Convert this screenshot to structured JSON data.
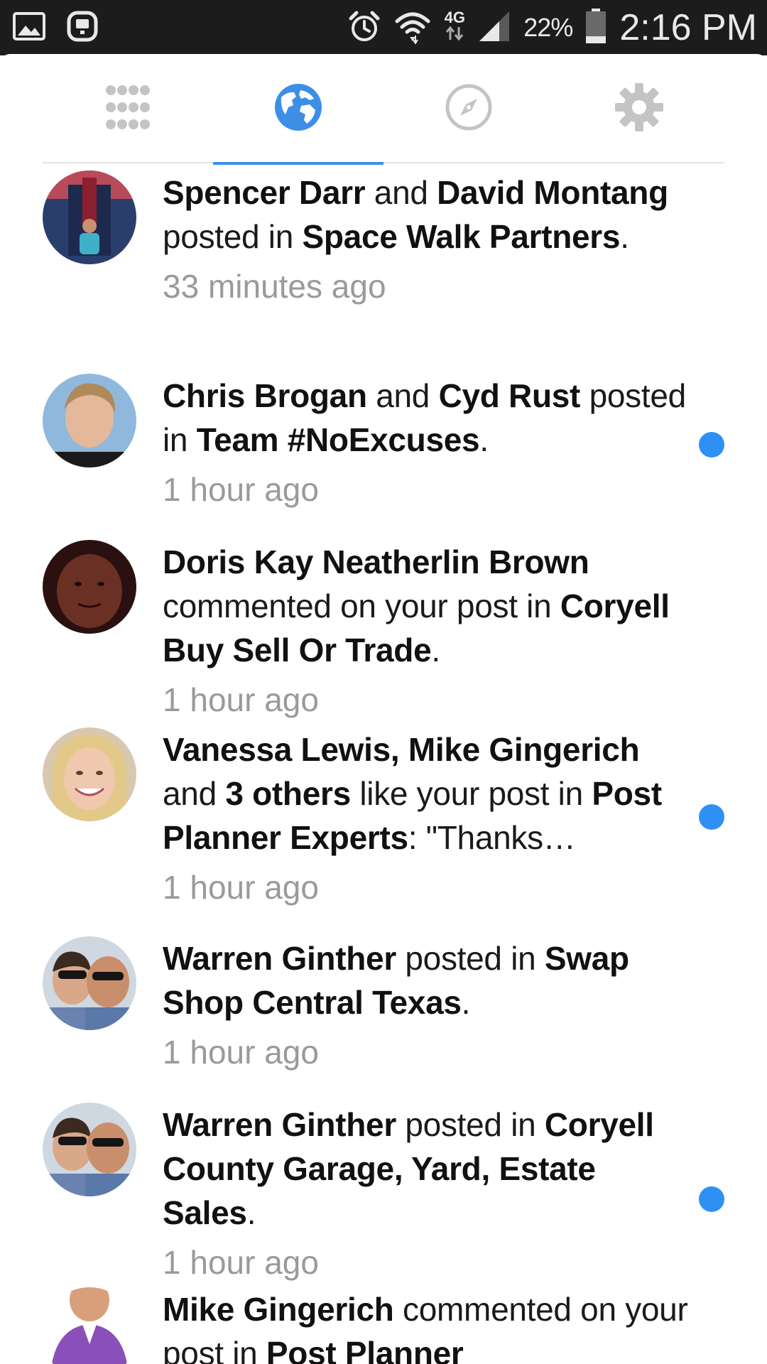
{
  "status_bar": {
    "network": "4G",
    "battery_percent": "22%",
    "battery_level": 0.22,
    "time": "2:16 PM",
    "icons": [
      "gallery-icon",
      "app-notification-icon",
      "alarm-icon",
      "wifi-icon",
      "data-arrows-icon",
      "signal-icon",
      "battery-icon"
    ]
  },
  "tabs": [
    {
      "name": "apps-grid-icon",
      "active": false
    },
    {
      "name": "notifications-globe-icon",
      "active": true
    },
    {
      "name": "explore-compass-icon",
      "active": false
    },
    {
      "name": "settings-gear-icon",
      "active": false
    }
  ],
  "colors": {
    "accent": "#3d8fe6",
    "unread": "#2e90f3",
    "timestamp": "#9a9a9a",
    "status_bar": "#1c1c1c"
  },
  "notifications": [
    {
      "segments": [
        {
          "t": "Spencer Darr",
          "b": true
        },
        {
          "t": " and ",
          "b": false
        },
        {
          "t": "David Montang",
          "b": true
        },
        {
          "t": " posted in ",
          "b": false
        },
        {
          "t": "Space Walk Partners",
          "b": true
        },
        {
          "t": ".",
          "b": false
        }
      ],
      "time": "33 minutes ago",
      "unread": false,
      "avatar": "person-red-backdrop"
    },
    {
      "segments": [
        {
          "t": "Chris Brogan",
          "b": true
        },
        {
          "t": " and ",
          "b": false
        },
        {
          "t": "Cyd Rust",
          "b": true
        },
        {
          "t": " posted in ",
          "b": false
        },
        {
          "t": "Team #NoExcuses",
          "b": true
        },
        {
          "t": ".",
          "b": false
        }
      ],
      "time": "1 hour ago",
      "unread": true,
      "avatar": "man-blonde-blue-sky"
    },
    {
      "segments": [
        {
          "t": "Doris Kay Neatherlin Brown",
          "b": true
        },
        {
          "t": " commented on your post in ",
          "b": false
        },
        {
          "t": "Coryell Buy Sell Or Trade",
          "b": true
        },
        {
          "t": ".",
          "b": false
        }
      ],
      "time": "1 hour ago",
      "unread": false,
      "avatar": "dark-closeup"
    },
    {
      "segments": [
        {
          "t": "Vanessa Lewis, Mike Gingerich",
          "b": true
        },
        {
          "t": " and ",
          "b": false
        },
        {
          "t": "3 others",
          "b": true
        },
        {
          "t": " like your post in ",
          "b": false
        },
        {
          "t": "Post Planner Experts",
          "b": true
        },
        {
          "t": ": \"Thanks…",
          "b": false
        }
      ],
      "time": "1 hour ago",
      "unread": true,
      "avatar": "woman-smiling-blonde"
    },
    {
      "segments": [
        {
          "t": "Warren Ginther",
          "b": true
        },
        {
          "t": " posted in ",
          "b": false
        },
        {
          "t": "Swap Shop Central Texas",
          "b": true
        },
        {
          "t": ".",
          "b": false
        }
      ],
      "time": "1 hour ago",
      "unread": false,
      "avatar": "couple-sunglasses"
    },
    {
      "segments": [
        {
          "t": "Warren Ginther",
          "b": true
        },
        {
          "t": " posted in ",
          "b": false
        },
        {
          "t": "Coryell County Garage, Yard, Estate Sales",
          "b": true
        },
        {
          "t": ".",
          "b": false
        }
      ],
      "time": "1 hour ago",
      "unread": true,
      "avatar": "couple-sunglasses"
    },
    {
      "segments": [
        {
          "t": "Mike Gingerich",
          "b": true
        },
        {
          "t": " commented on your post in ",
          "b": false
        },
        {
          "t": "Post Planner",
          "b": true
        }
      ],
      "time": "",
      "unread": false,
      "avatar": "man-purple-shirt"
    }
  ]
}
